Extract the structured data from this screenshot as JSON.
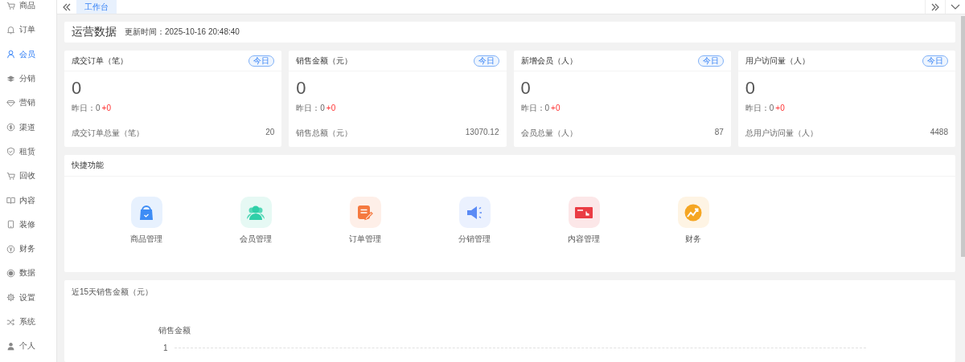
{
  "sidebar": {
    "items": [
      {
        "label": "商品",
        "selected": false
      },
      {
        "label": "订单",
        "selected": false
      },
      {
        "label": "会员",
        "selected": true
      },
      {
        "label": "分销",
        "selected": false
      },
      {
        "label": "营销",
        "selected": false
      },
      {
        "label": "渠道",
        "selected": false
      },
      {
        "label": "租赁",
        "selected": false
      },
      {
        "label": "回收",
        "selected": false
      },
      {
        "label": "内容",
        "selected": false
      },
      {
        "label": "装修",
        "selected": false
      },
      {
        "label": "财务",
        "selected": false
      },
      {
        "label": "数据",
        "selected": false
      },
      {
        "label": "设置",
        "selected": false
      },
      {
        "label": "系统",
        "selected": false
      },
      {
        "label": "个人",
        "selected": false
      }
    ]
  },
  "tabs": [
    {
      "label": "工作台",
      "selected": true
    }
  ],
  "header": {
    "title": "运营数据",
    "updated": "更新时间：2025-10-16 20:48:40"
  },
  "stats": [
    {
      "title": "成交订单（笔）",
      "badge": "今日",
      "value": "0",
      "yesterday": "昨日：0",
      "change": "+0",
      "total_label": "成交订单总量（笔）",
      "total": "20"
    },
    {
      "title": "销售金额（元）",
      "badge": "今日",
      "value": "0",
      "yesterday": "昨日：0",
      "change": "+0",
      "total_label": "销售总额（元）",
      "total": "13070.12"
    },
    {
      "title": "新增会员（人）",
      "badge": "今日",
      "value": "0",
      "yesterday": "昨日：0",
      "change": "+0",
      "total_label": "会员总量（人）",
      "total": "87"
    },
    {
      "title": "用户访问量（人）",
      "badge": "今日",
      "value": "0",
      "yesterday": "昨日：0",
      "change": "+0",
      "total_label": "总用户访问量（人）",
      "total": "4488"
    }
  ],
  "shortcuts": {
    "title": "快捷功能",
    "items": [
      {
        "label": "商品管理",
        "color": "#3d8cf5"
      },
      {
        "label": "会员管理",
        "color": "#2fcfa8"
      },
      {
        "label": "订单管理",
        "color": "#f5793f"
      },
      {
        "label": "分销管理",
        "color": "#5b8bf5"
      },
      {
        "label": "内容管理",
        "color": "#ea3c44"
      },
      {
        "label": "财务",
        "color": "#f5a623"
      }
    ]
  },
  "sales_chart": {
    "title": "近15天销售金额（元）",
    "axis_label": "销售金额",
    "ticks": [
      "1"
    ]
  }
}
